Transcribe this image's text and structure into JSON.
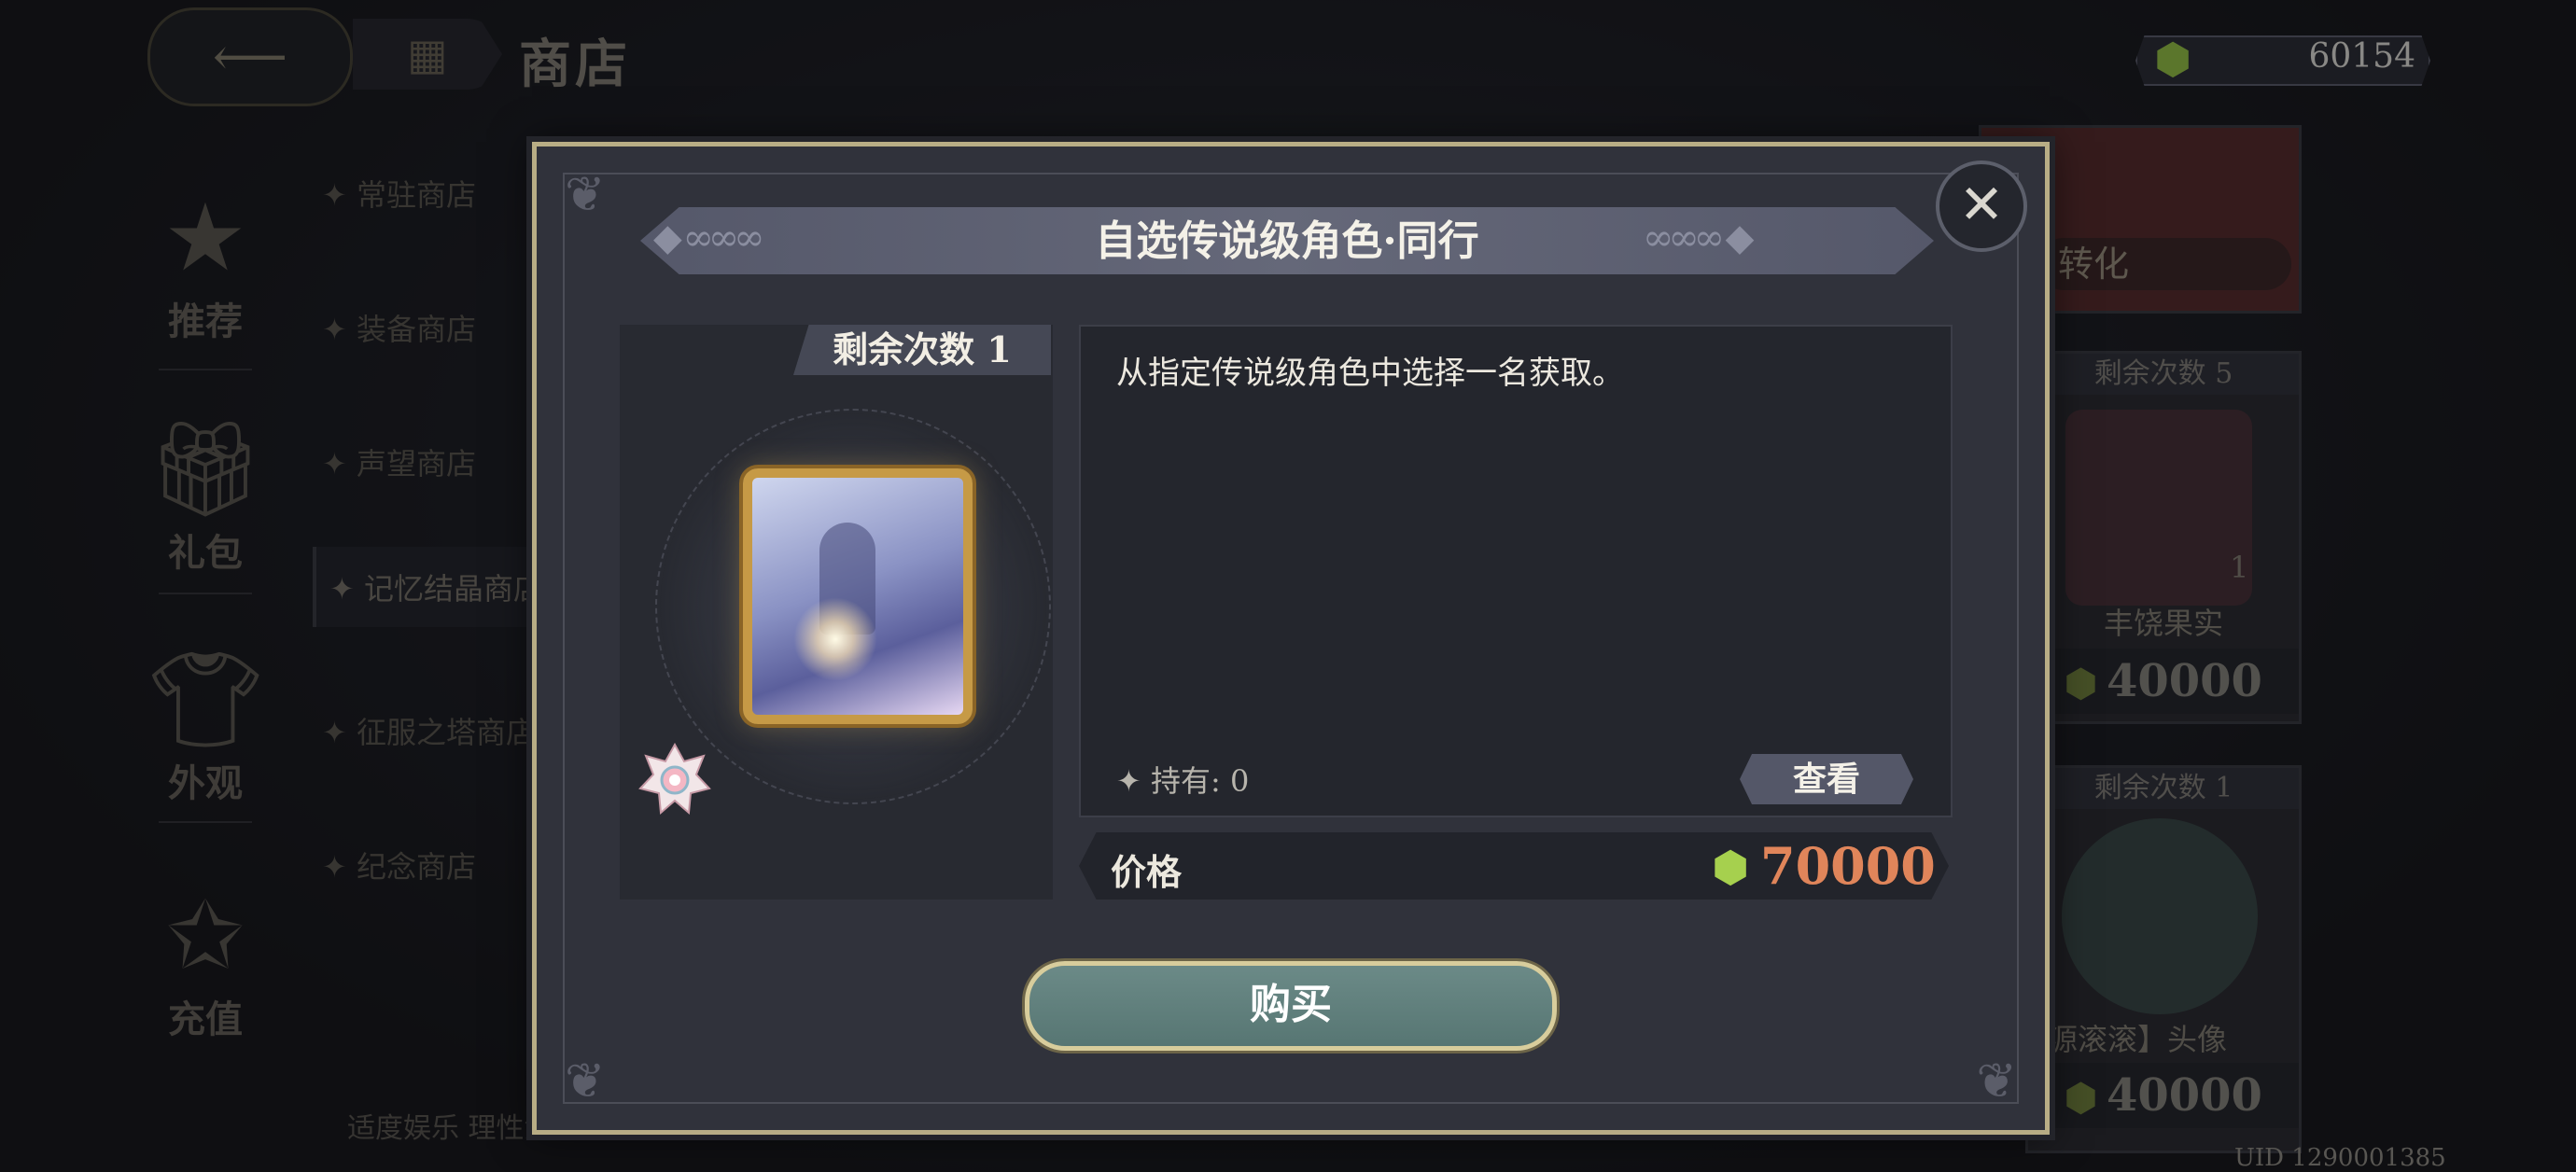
{
  "header": {
    "back_icon": "arrow-left-icon",
    "menu_icon": "grid-icon",
    "title": "商店",
    "currency_value": "60154",
    "currency_icon": "green-gem-icon"
  },
  "nav": [
    {
      "label": "推荐",
      "icon": "star-banner-icon"
    },
    {
      "label": "礼包",
      "icon": "gift-icon"
    },
    {
      "label": "外观",
      "icon": "shirt-icon"
    },
    {
      "label": "充值",
      "icon": "star-sparkle-icon"
    }
  ],
  "sub_shops": [
    "✦ 常驻商店",
    "✦ 装备商店",
    "✦ 声望商店",
    "✦ 记忆结晶商店",
    "✦ 征服之塔商店",
    "✦ 纪念商店"
  ],
  "disclaimer": "适度娱乐 理性消费",
  "uid": "UID 1290001385",
  "bg_cards": {
    "banner_label": "转化",
    "card1": {
      "remaining": "剩余次数 5",
      "name": "丰饶果实",
      "count": "1",
      "price": "40000"
    },
    "card2": {
      "remaining": "剩余次数 1",
      "name": "【财源滚滚】头像",
      "price": "40000"
    }
  },
  "modal": {
    "title": "自选传说级角色·同行",
    "remaining": "剩余次数 1",
    "description": "从指定传说级角色中选择一名获取。",
    "holding": "✦ 持有: 0",
    "view_button": "查看",
    "price_label": "价格",
    "price_value": "70000",
    "buy_button": "购买",
    "close_icon": "close-icon"
  },
  "colors": {
    "modal_border": "#b8ad85",
    "price_text": "#e0855a",
    "buy_button": "#6b8a87",
    "gem": "#a6d04e"
  }
}
